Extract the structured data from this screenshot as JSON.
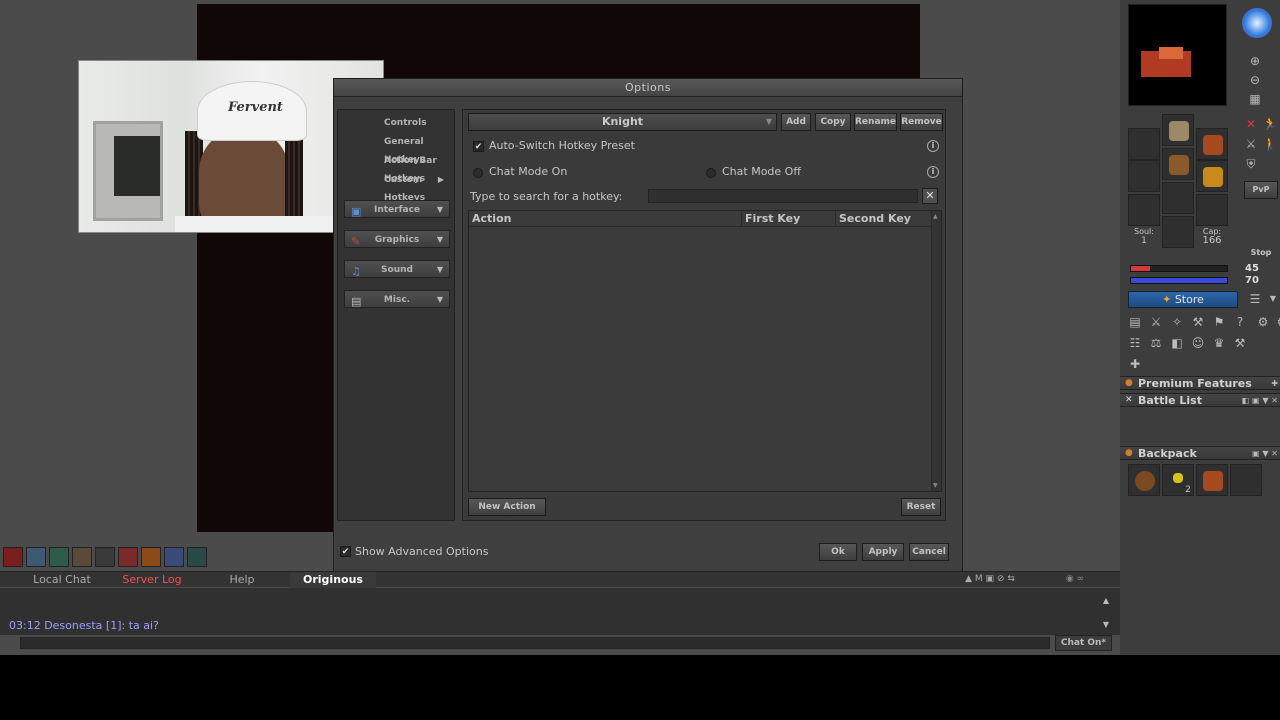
{
  "options": {
    "title": "Options",
    "nav": {
      "controls": "Controls",
      "general_hotkeys": "General Hotkeys",
      "action_bar_hotkeys": "Action Bar Hotkeys",
      "custom_hotkeys": "Custom Hotkeys",
      "interface": "Interface",
      "graphics": "Graphics",
      "sound": "Sound",
      "misc": "Misc."
    },
    "preset": "Knight",
    "buttons": {
      "add": "Add",
      "copy": "Copy",
      "rename": "Rename",
      "remove": "Remove"
    },
    "auto_switch": "Auto-Switch Hotkey Preset",
    "chat_mode_on": "Chat Mode On",
    "chat_mode_off": "Chat Mode Off",
    "search_label": "Type to search for a hotkey:",
    "columns": {
      "action": "Action",
      "first_key": "First Key",
      "second_key": "Second Key"
    },
    "new_action": "New Action",
    "reset": "Reset",
    "show_advanced": "Show Advanced Options",
    "ok": "Ok",
    "apply": "Apply",
    "cancel": "Cancel"
  },
  "webcam": {
    "cap_text": "Fervent"
  },
  "sidebar": {
    "soul_label": "Soul:",
    "soul_value": "1",
    "cap_label": "Cap:",
    "cap_value": "166",
    "stop": "Stop",
    "pvp": "PvP",
    "hp": "45",
    "mana": "70",
    "hp_percent": 20,
    "mana_percent": 100,
    "store": "Store",
    "premium": "Premium Features",
    "battle_list": "Battle List",
    "backpack": "Backpack",
    "backpack_count": "2"
  },
  "chat": {
    "tabs": [
      "Local Chat",
      "Server Log",
      "Help",
      "Originous"
    ],
    "message": "03:12 Desonesta [1]: ta ai?",
    "chat_on": "Chat On*"
  },
  "colors": {
    "server_log": "#ff4d4d",
    "message": "#9f9fff",
    "hp_bar": "#d9363e",
    "mana_bar": "#3a4bd9",
    "store": "#2c66a8"
  }
}
